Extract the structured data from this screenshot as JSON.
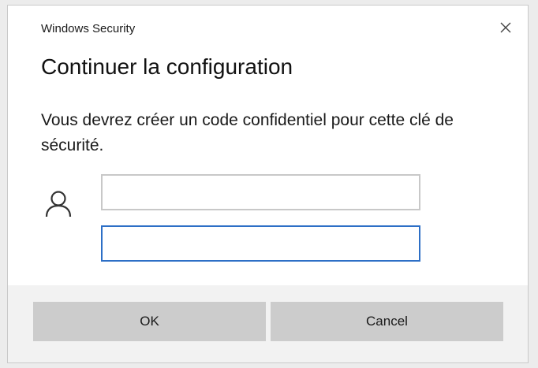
{
  "window": {
    "title": "Windows Security",
    "close_icon": "close-icon"
  },
  "dialog": {
    "heading": "Continuer la configuration",
    "message": "Vous devrez créer un code confidentiel pour cette clé de sécurité."
  },
  "form": {
    "user_icon": "user-icon",
    "field_1_value": "",
    "field_2_value": ""
  },
  "buttons": {
    "ok_label": "OK",
    "cancel_label": "Cancel"
  },
  "colors": {
    "focus_border": "#2d6fc6",
    "button_bg": "#cccccc",
    "footer_bg": "#f2f2f2"
  }
}
